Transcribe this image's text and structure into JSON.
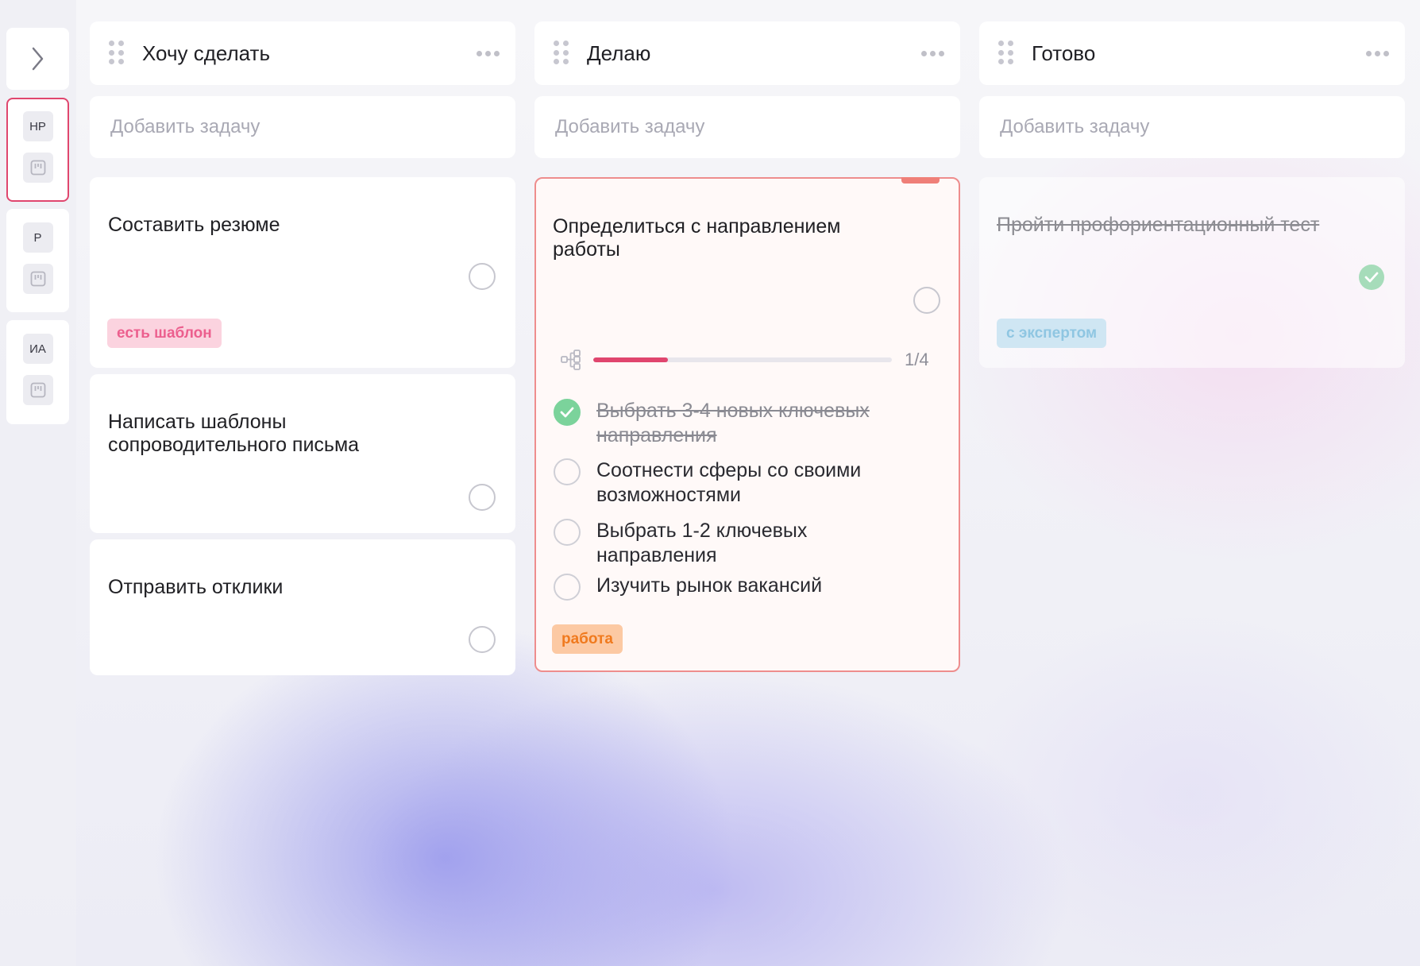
{
  "sidebar": {
    "groups": [
      {
        "avatar": "НР",
        "active": true
      },
      {
        "avatar": "Р",
        "active": false
      },
      {
        "avatar": "ИА",
        "active": false
      }
    ]
  },
  "columns": [
    {
      "title": "Хочу сделать",
      "add_placeholder": "Добавить задачу",
      "cards": [
        {
          "title": "Составить резюме",
          "tag": "есть шаблон"
        },
        {
          "title": "Написать шаблоны\nсопроводительного письма"
        },
        {
          "title": "Отправить отклики"
        }
      ]
    },
    {
      "title": "Делаю",
      "add_placeholder": "Добавить задачу",
      "cards": [
        {
          "title": "Определиться с направлением\nработы",
          "progress": {
            "done": 1,
            "total": 4,
            "label": "1/4"
          },
          "subtasks": [
            {
              "text": "Выбрать 3-4 новых ключевых направления",
              "done": true
            },
            {
              "text": "Соотнести сферы со своими возможностями",
              "done": false
            },
            {
              "text": "Выбрать 1-2 ключевых направления",
              "done": false
            },
            {
              "text": "Изучить рынок вакансий",
              "done": false
            }
          ],
          "tag": "работа"
        }
      ]
    },
    {
      "title": "Готово",
      "add_placeholder": "Добавить задачу",
      "cards": [
        {
          "title": "Пройти профориентационный тест",
          "tag": "с экспертом",
          "done": true
        }
      ]
    }
  ],
  "colors": {
    "accent": "#e0466e",
    "tag_pink_bg": "#fbd3df",
    "tag_pink_fg": "#ec5f8e",
    "tag_orange_bg": "#fcc9a3",
    "tag_orange_fg": "#f07a1e",
    "tag_blue_bg": "#cfe6f3",
    "tag_blue_fg": "#8fc6e2",
    "check_green": "#7bd39b"
  }
}
